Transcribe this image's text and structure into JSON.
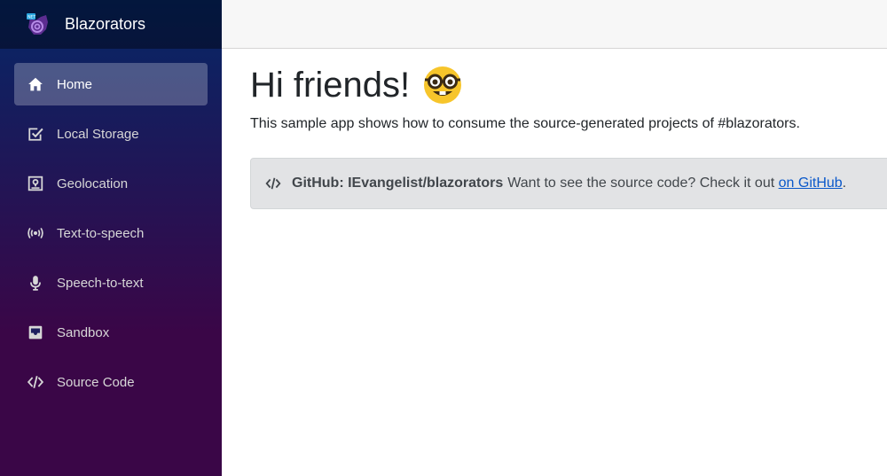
{
  "brand": {
    "name": "Blazorators",
    "logo_icon": "blazor-logo-icon"
  },
  "nav": {
    "items": [
      {
        "label": "Home",
        "icon": "home-icon",
        "active": true
      },
      {
        "label": "Local Storage",
        "icon": "check-square-icon"
      },
      {
        "label": "Geolocation",
        "icon": "geolocation-icon"
      },
      {
        "label": "Text-to-speech",
        "icon": "broadcast-icon"
      },
      {
        "label": "Speech-to-text",
        "icon": "microphone-icon"
      },
      {
        "label": "Sandbox",
        "icon": "inbox-icon"
      },
      {
        "label": "Source Code",
        "icon": "code-icon"
      }
    ]
  },
  "main": {
    "title": "Hi friends!",
    "title_emoji": "nerd-face-emoji",
    "intro": "This sample app shows how to consume the source-generated projects of #blazorators.",
    "callout": {
      "icon": "code-icon",
      "heading": "GitHub: IEvangelist/blazorators",
      "text": "Want to see the source code? Check it out",
      "link_text": "on GitHub",
      "trailing": "."
    }
  },
  "colors": {
    "sidebar_gradient_start": "#052767",
    "sidebar_gradient_end": "#3a0647",
    "link": "#0a58ca",
    "alert_bg": "#e2e3e5"
  }
}
